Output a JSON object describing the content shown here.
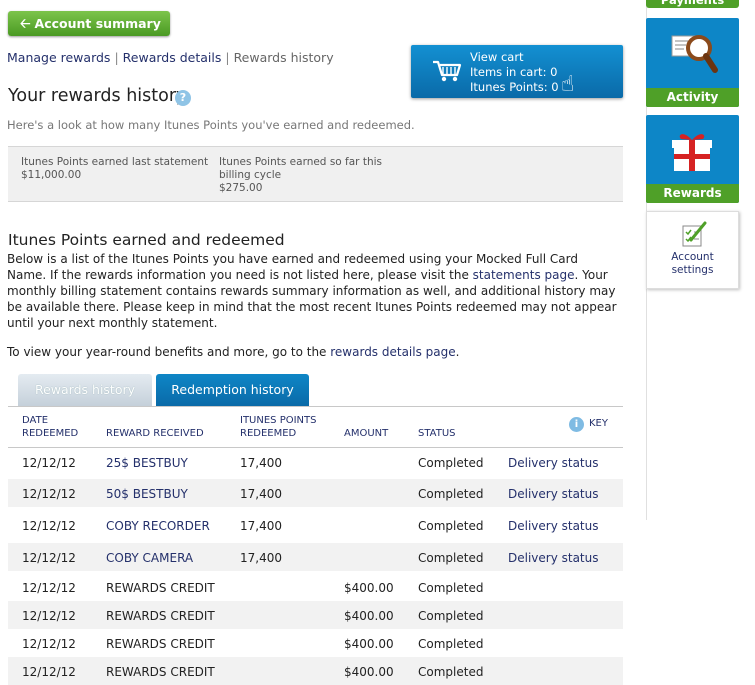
{
  "nav": {
    "back_label": "Account summary"
  },
  "subnav": {
    "manage": "Manage rewards",
    "details": "Rewards details",
    "history": "Rewards history",
    "sep": "|"
  },
  "cart": {
    "view": "View cart",
    "items": "Items in cart: 0",
    "points": "Itunes Points: 0"
  },
  "page": {
    "title": "Your rewards history",
    "help": "?",
    "intro": "Here's a look at how many Itunes Points you've earned and redeemed."
  },
  "summary": {
    "earned_label": "Itunes Points earned last statement",
    "earned_value": "$11,000.00",
    "cycle_label": "Itunes Points earned so far this billing cycle",
    "cycle_value": "$275.00"
  },
  "section": {
    "title": "Itunes Points earned and redeemed",
    "p1_a": "Below is a list of the Itunes Points you have earned and redeemed using your Mocked Full Card Name. If the rewards information you need is not listed here, please visit the ",
    "p1_link": "statements page",
    "p1_b": ". Your monthly billing statement contains rewards summary information as well, and additional history may be available there. Please keep in mind that the most recent Itunes Points redeemed may not appear until your next monthly statement.",
    "p2_a": "To view your year-round benefits and more, go to the ",
    "p2_link": "rewards details page",
    "p2_b": "."
  },
  "tabs": {
    "rewards": "Rewards history",
    "redemption": "Redemption history"
  },
  "table": {
    "headers": {
      "date_1": "DATE",
      "date_2": "REDEEMED",
      "reward": "REWARD RECEIVED",
      "pts_1": "ITUNES POINTS",
      "pts_2": "REDEEMED",
      "amount": "AMOUNT",
      "status": "STATUS",
      "key_icon": "i",
      "key": "KEY"
    },
    "rows": [
      {
        "date": "12/12/12",
        "reward": "25$ BESTBUY",
        "points": "17,400",
        "amount": "",
        "status": "Completed",
        "delivery": "Delivery status"
      },
      {
        "date": "12/12/12",
        "reward": "50$ BESTBUY",
        "points": "17,400",
        "amount": "",
        "status": "Completed",
        "delivery": "Delivery status"
      },
      {
        "date": "12/12/12",
        "reward": "COBY RECORDER",
        "points": "17,400",
        "amount": "",
        "status": "Completed",
        "delivery": "Delivery status"
      },
      {
        "date": "12/12/12",
        "reward": "COBY CAMERA",
        "points": "17,400",
        "amount": "",
        "status": "Completed",
        "delivery": "Delivery status"
      },
      {
        "date": "12/12/12",
        "reward": "REWARDS CREDIT",
        "points": "",
        "amount": "$400.00",
        "status": "Completed",
        "delivery": ""
      },
      {
        "date": "12/12/12",
        "reward": "REWARDS CREDIT",
        "points": "",
        "amount": "$400.00",
        "status": "Completed",
        "delivery": ""
      },
      {
        "date": "12/12/12",
        "reward": "REWARDS CREDIT",
        "points": "",
        "amount": "$400.00",
        "status": "Completed",
        "delivery": ""
      },
      {
        "date": "12/12/12",
        "reward": "REWARDS CREDIT",
        "points": "",
        "amount": "$400.00",
        "status": "Completed",
        "delivery": ""
      }
    ]
  },
  "rail": {
    "payments": "Payments",
    "activity": "Activity",
    "rewards": "Rewards",
    "settings_1": "Account",
    "settings_2": "settings"
  },
  "colors": {
    "link": "#24306b",
    "green": "#4fa028",
    "blue": "#0d86c7"
  }
}
